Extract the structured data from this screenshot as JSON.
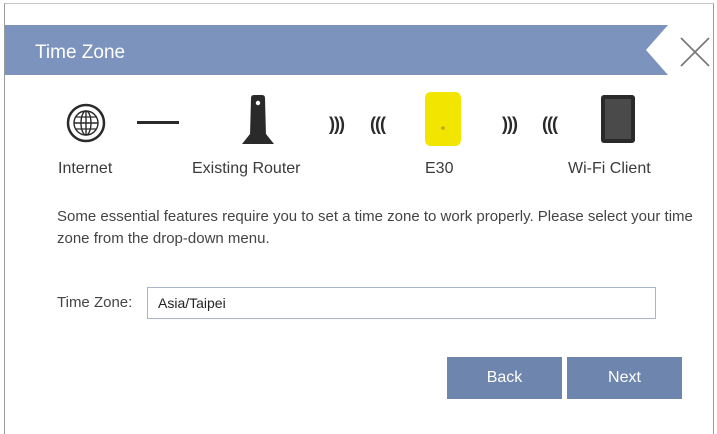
{
  "header": {
    "title": "Time Zone",
    "close_icon": "close-icon"
  },
  "topology": {
    "devices": [
      {
        "label": "Internet",
        "icon": "globe-icon"
      },
      {
        "label": "Existing Router",
        "icon": "router-icon"
      },
      {
        "label": "E30",
        "icon": "extender-icon"
      },
      {
        "label": "Wi-Fi Client",
        "icon": "tablet-icon"
      }
    ],
    "wave_right": ")))",
    "wave_left": "((("
  },
  "description": "Some essential features require you to set a time zone to work properly. Please select your time zone from the drop-down menu.",
  "timezone": {
    "label": "Time Zone:",
    "value": "Asia/Taipei"
  },
  "buttons": {
    "back": "Back",
    "next": "Next"
  },
  "colors": {
    "header": "#7c93bd",
    "button": "#6e86ad",
    "extender": "#f2e600"
  }
}
